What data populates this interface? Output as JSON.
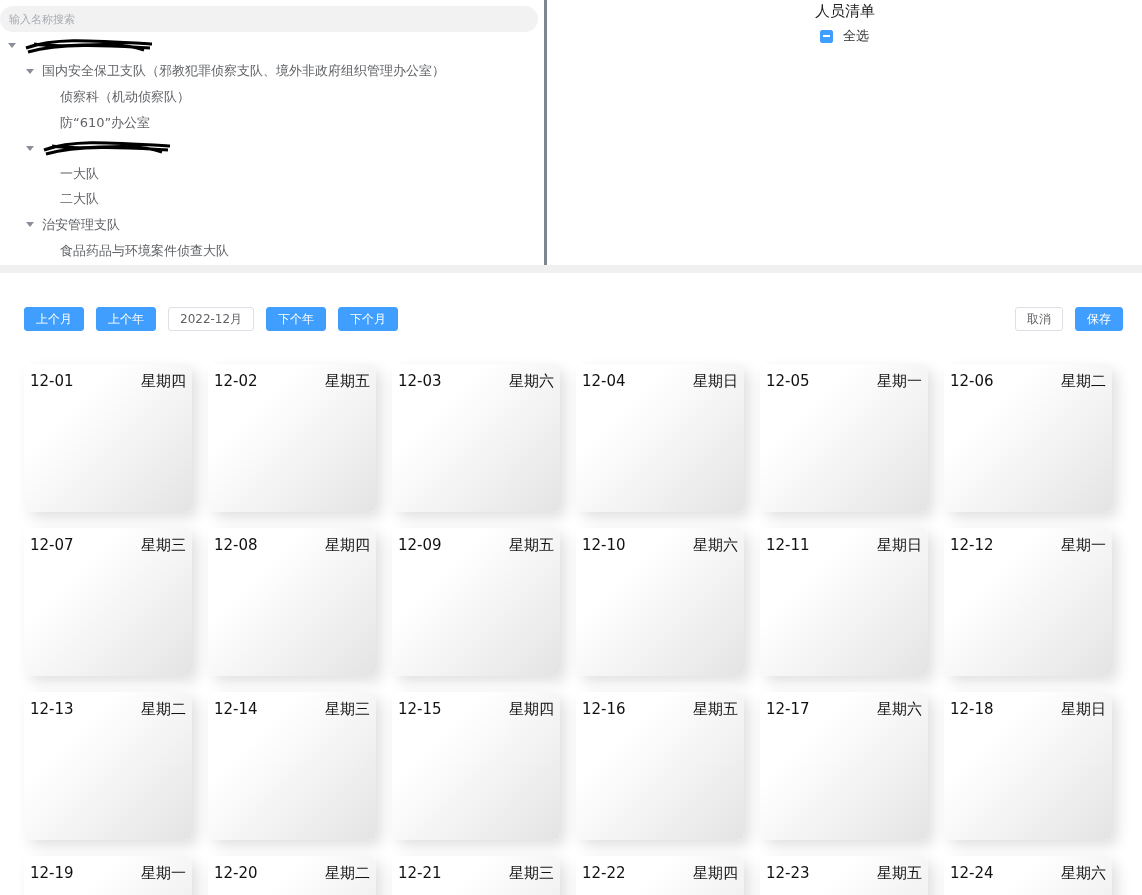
{
  "tree": {
    "search": {
      "placeholder": "输入名称搜索"
    },
    "nodes": [
      {
        "kind": "redacted",
        "expanded": true,
        "children": [
          {
            "kind": "text",
            "label": "国内安全保卫支队（邪教犯罪侦察支队、境外非政府组织管理办公室）",
            "expanded": true,
            "children": [
              {
                "kind": "text",
                "label": "侦察科（机动侦察队）"
              },
              {
                "kind": "text",
                "label": "防“610”办公室"
              }
            ]
          },
          {
            "kind": "redacted",
            "expanded": true,
            "children": [
              {
                "kind": "text",
                "label": "一大队"
              },
              {
                "kind": "text",
                "label": "二大队"
              }
            ]
          },
          {
            "kind": "text",
            "label": "治安管理支队",
            "expanded": true,
            "children": [
              {
                "kind": "text",
                "label": "食品药品与环境案件侦查大队"
              }
            ]
          }
        ]
      }
    ]
  },
  "people": {
    "title": "人员清单",
    "select_all": {
      "label": "全选",
      "indeterminate": true
    }
  },
  "toolbar": {
    "left": [
      {
        "kind": "primary",
        "label": "上个月"
      },
      {
        "kind": "primary",
        "label": "上个年"
      },
      {
        "kind": "plain",
        "label": "2022-12月"
      },
      {
        "kind": "primary",
        "label": "下个年"
      },
      {
        "kind": "primary",
        "label": "下个月"
      }
    ],
    "right": [
      {
        "kind": "plain",
        "label": "取消"
      },
      {
        "kind": "primary",
        "label": "保存"
      }
    ]
  },
  "days": [
    {
      "date": "12-01",
      "weekday": "星期四"
    },
    {
      "date": "12-02",
      "weekday": "星期五"
    },
    {
      "date": "12-03",
      "weekday": "星期六"
    },
    {
      "date": "12-04",
      "weekday": "星期日"
    },
    {
      "date": "12-05",
      "weekday": "星期一"
    },
    {
      "date": "12-06",
      "weekday": "星期二"
    },
    {
      "date": "12-07",
      "weekday": "星期三"
    },
    {
      "date": "12-08",
      "weekday": "星期四"
    },
    {
      "date": "12-09",
      "weekday": "星期五"
    },
    {
      "date": "12-10",
      "weekday": "星期六"
    },
    {
      "date": "12-11",
      "weekday": "星期日"
    },
    {
      "date": "12-12",
      "weekday": "星期一"
    },
    {
      "date": "12-13",
      "weekday": "星期二"
    },
    {
      "date": "12-14",
      "weekday": "星期三"
    },
    {
      "date": "12-15",
      "weekday": "星期四"
    },
    {
      "date": "12-16",
      "weekday": "星期五"
    },
    {
      "date": "12-17",
      "weekday": "星期六"
    },
    {
      "date": "12-18",
      "weekday": "星期日"
    },
    {
      "date": "12-19",
      "weekday": "星期一"
    },
    {
      "date": "12-20",
      "weekday": "星期二"
    },
    {
      "date": "12-21",
      "weekday": "星期三"
    },
    {
      "date": "12-22",
      "weekday": "星期四"
    },
    {
      "date": "12-23",
      "weekday": "星期五"
    },
    {
      "date": "12-24",
      "weekday": "星期六"
    }
  ]
}
